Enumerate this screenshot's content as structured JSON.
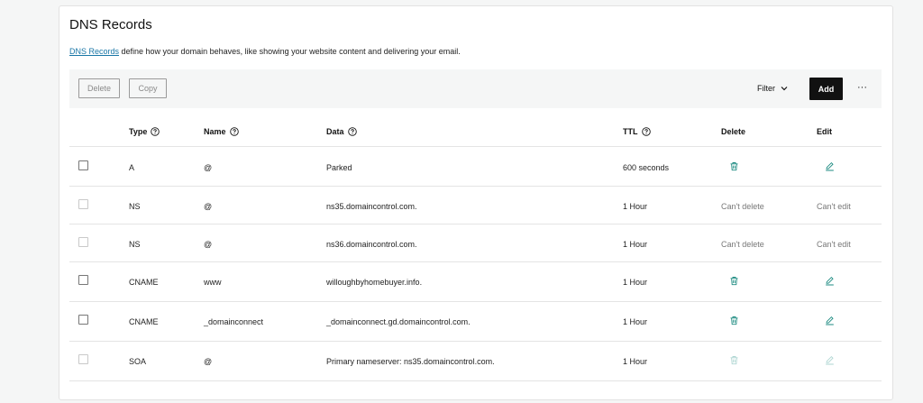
{
  "page": {
    "title": "DNS Records",
    "intro_link": "DNS Records",
    "intro_text": " define how your domain behaves, like showing your website content and delivering your email."
  },
  "toolbar": {
    "delete_label": "Delete",
    "copy_label": "Copy",
    "filter_label": "Filter",
    "add_label": "Add",
    "more_label": "···"
  },
  "table": {
    "headers": {
      "type": "Type",
      "name": "Name",
      "data": "Data",
      "ttl": "TTL",
      "delete": "Delete",
      "edit": "Edit"
    },
    "rows": [
      {
        "type": "A",
        "name": "@",
        "data": "Parked",
        "ttl": "600 seconds",
        "delete": "",
        "edit": ""
      },
      {
        "type": "NS",
        "name": "@",
        "data": "ns35.domaincontrol.com.",
        "ttl": "1 Hour",
        "delete": "Can't delete",
        "edit": "Can't edit"
      },
      {
        "type": "NS",
        "name": "@",
        "data": "ns36.domaincontrol.com.",
        "ttl": "1 Hour",
        "delete": "Can't delete",
        "edit": "Can't edit"
      },
      {
        "type": "CNAME",
        "name": "www",
        "data": "willoughbyhomebuyer.info.",
        "ttl": "1 Hour",
        "delete": "",
        "edit": ""
      },
      {
        "type": "CNAME",
        "name": "_domainconnect",
        "data": "_domainconnect.gd.domaincontrol.com.",
        "ttl": "1 Hour",
        "delete": "",
        "edit": ""
      },
      {
        "type": "SOA",
        "name": "@",
        "data": "Primary nameserver: ns35.domaincontrol.com.",
        "ttl": "1 Hour",
        "delete": "",
        "edit": ""
      }
    ]
  },
  "colors": {
    "accent_teal": "#1b8a80",
    "link": "#1976a6",
    "add_button": "#111111"
  },
  "icons": {
    "help": "question-circle-icon",
    "delete": "trash-icon",
    "edit": "pencil-icon",
    "filter": "chevron-down-icon"
  }
}
